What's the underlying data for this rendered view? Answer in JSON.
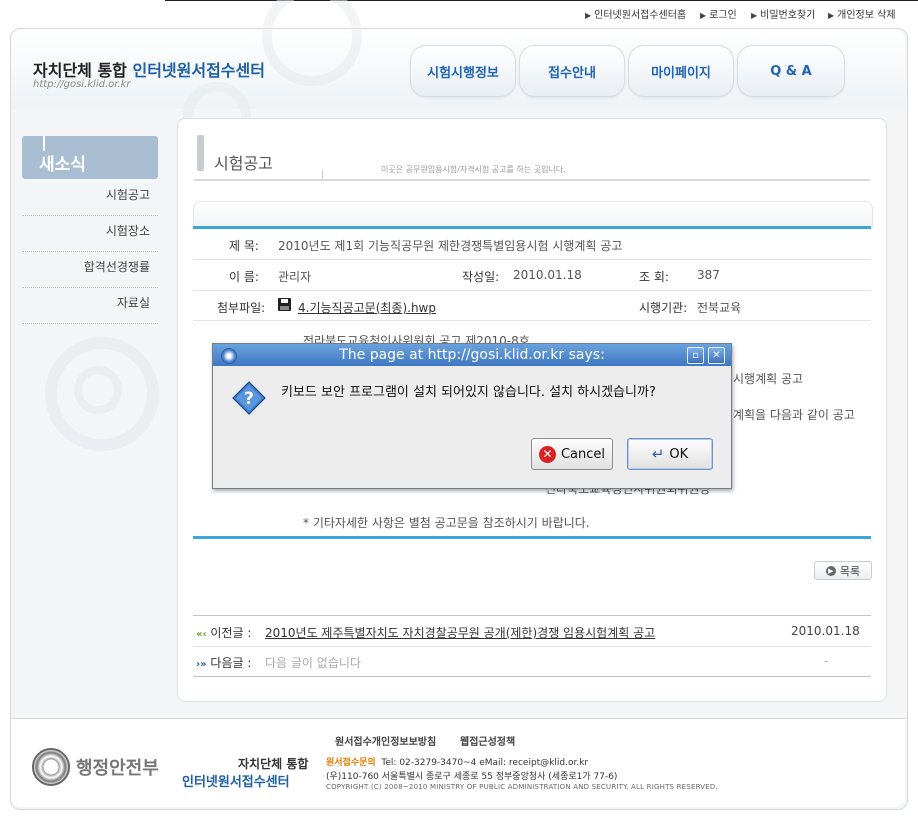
{
  "utility_links": [
    "인터넷원서접수센터홈",
    "로그인",
    "비밀번호찾기",
    "개인정보 삭제"
  ],
  "header": {
    "logo_main": "자치단체 통합",
    "logo_accent": "인터넷원서접수센터",
    "logo_url": "http://gosi.klid.or.kr",
    "tabs": [
      "시험시행정보",
      "접수안내",
      "마이페이지",
      "Q & A"
    ]
  },
  "sidebar": {
    "title": "새소식",
    "items": [
      "시험공고",
      "시험장소",
      "합격선경쟁률",
      "자료실"
    ]
  },
  "content": {
    "title": "시험공고",
    "description": "이곳은 공무원임용시험/자격시험 공고를 하는 곳입니다.",
    "subject_label": "제  목:",
    "subject_value": "2010년도 제1회 기능직공무원 제한경쟁특별임용시험 시행계획 공고",
    "name_label": "이  름:",
    "name_value": "관리자",
    "date_label": "작성일:",
    "date_value": "2010.01.18",
    "views_label": "조   회:",
    "views_value": "387",
    "attach_label": "첨부파일:",
    "attach_file": "4.기능직공고문(최종).hwp",
    "agency_label": "시행기관:",
    "agency_value": "전북교육",
    "body_line1": "전라북도교육청인사위원회 공고 제2010-8호",
    "body_frag1": "시행계획 공고",
    "body_frag2": "계획을 다음과 같이 공고",
    "body_line_sig": "전라북도교육청인사위원회위원장",
    "body_note": "* 기타자세한 사항은 별첨 공고문을 참조하시기 바랍니다.",
    "list_button": "목록",
    "prev_label": "이전글 :",
    "prev_title": "2010년도 제주특별자치도 자치경찰공무원 공개(제한)경쟁 임용시험계획 공고",
    "prev_date": "2010.01.18",
    "next_label": "다음글 :",
    "next_title": "다음 글이 없습니다",
    "next_date": "-"
  },
  "footer": {
    "links": [
      "원서접수개인정보보방침",
      "웹접근성정책"
    ],
    "ministry": "행정안전부",
    "brand1": "자치단체 통합",
    "brand2": "인터넷원서접수센터",
    "contact_label": "원서접수문의",
    "contact_info": "Tel: 02-3279-3470~4  eMail: receipt@klid.or.kr",
    "address": "(우)110-760 서울특별시 종로구 세종로 55 정부중앙청사 (세종로1가 77-6)",
    "copyright": "COPYRIGHT (C) 2008~2010 MINISTRY OF PUBLIC ADMINISTRATION AND SECURITY. ALL RIGHTS RESERVED."
  },
  "dialog": {
    "title": "The page at http://gosi.klid.or.kr says:",
    "message": "키보드 보안 프로그램이 설치 되어있지 않습니다. 설치 하시겠습니까?",
    "cancel_label": "Cancel",
    "ok_label": "OK"
  },
  "colors": {
    "accent_blue": "#3aa6dc",
    "brand_blue": "#1e5fa8",
    "dialog_title": "#4a82cc"
  }
}
